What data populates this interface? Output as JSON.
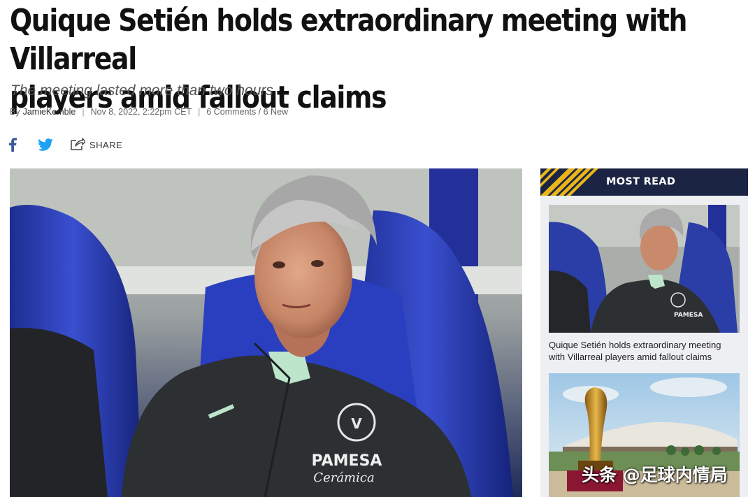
{
  "article": {
    "headline_line1": "Quique Setién holds extraordinary meeting with Villarreal",
    "headline_line2": "players amid fallout claims",
    "dek": "The meeting lasted more than two hours",
    "byline_prefix": "By",
    "author": "JamieKemble",
    "sep": "|",
    "date": "Nov 8, 2022, 2:22pm CET",
    "comments": "6 Comments / 6 New"
  },
  "share": {
    "label": "SHARE",
    "icons": [
      "facebook-icon",
      "twitter-icon",
      "share-icon"
    ]
  },
  "sidebar": {
    "title": "MOST READ",
    "items": [
      {
        "caption": "Quique Setién holds extraordinary meeting with Villarreal players amid fallout claims"
      }
    ]
  },
  "hero": {
    "jacket_brand": "PAMESA",
    "jacket_sub": "Cerámica"
  },
  "watermark": "头条 @足球内情局",
  "colors": {
    "brand_navy": "#1b2443",
    "accent_gold": "#e8b51a",
    "facebook_blue": "#3b5998",
    "twitter_blue": "#1da1f2",
    "seat_blue": "#2b3ea8"
  }
}
